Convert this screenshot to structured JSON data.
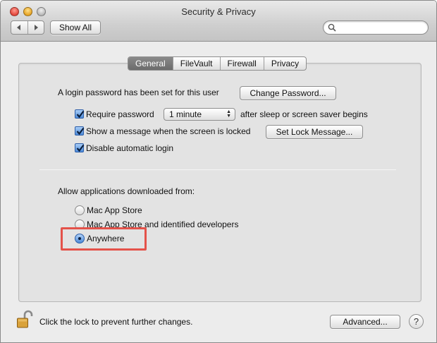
{
  "window": {
    "title": "Security & Privacy"
  },
  "toolbar": {
    "back_icon": "back-arrow-icon",
    "forward_icon": "forward-arrow-icon",
    "show_all_label": "Show All",
    "search_placeholder": "",
    "search_value": ""
  },
  "tabs": [
    {
      "label": "General",
      "active": true
    },
    {
      "label": "FileVault",
      "active": false
    },
    {
      "label": "Firewall",
      "active": false
    },
    {
      "label": "Privacy",
      "active": false
    }
  ],
  "general": {
    "login_password_text": "A login password has been set for this user",
    "change_password_label": "Change Password...",
    "require_password_label": "Require password",
    "require_password_checked": true,
    "require_password_delay": "1 minute",
    "after_sleep_text": "after sleep or screen saver begins",
    "show_message_label": "Show a message when the screen is locked",
    "show_message_checked": true,
    "set_lock_message_label": "Set Lock Message...",
    "disable_auto_login_label": "Disable automatic login",
    "disable_auto_login_checked": true,
    "allow_apps_heading": "Allow applications downloaded from:",
    "app_sources": [
      {
        "label": "Mac App Store",
        "selected": false
      },
      {
        "label": "Mac App Store and identified developers",
        "selected": false
      },
      {
        "label": "Anywhere",
        "selected": true
      }
    ]
  },
  "footer": {
    "lock_text": "Click the lock to prevent further changes.",
    "advanced_label": "Advanced...",
    "help_label": "?"
  },
  "colors": {
    "highlight": "#e4524a",
    "accent": "#4c8ad8",
    "active_tab": "#6b6b6b"
  }
}
